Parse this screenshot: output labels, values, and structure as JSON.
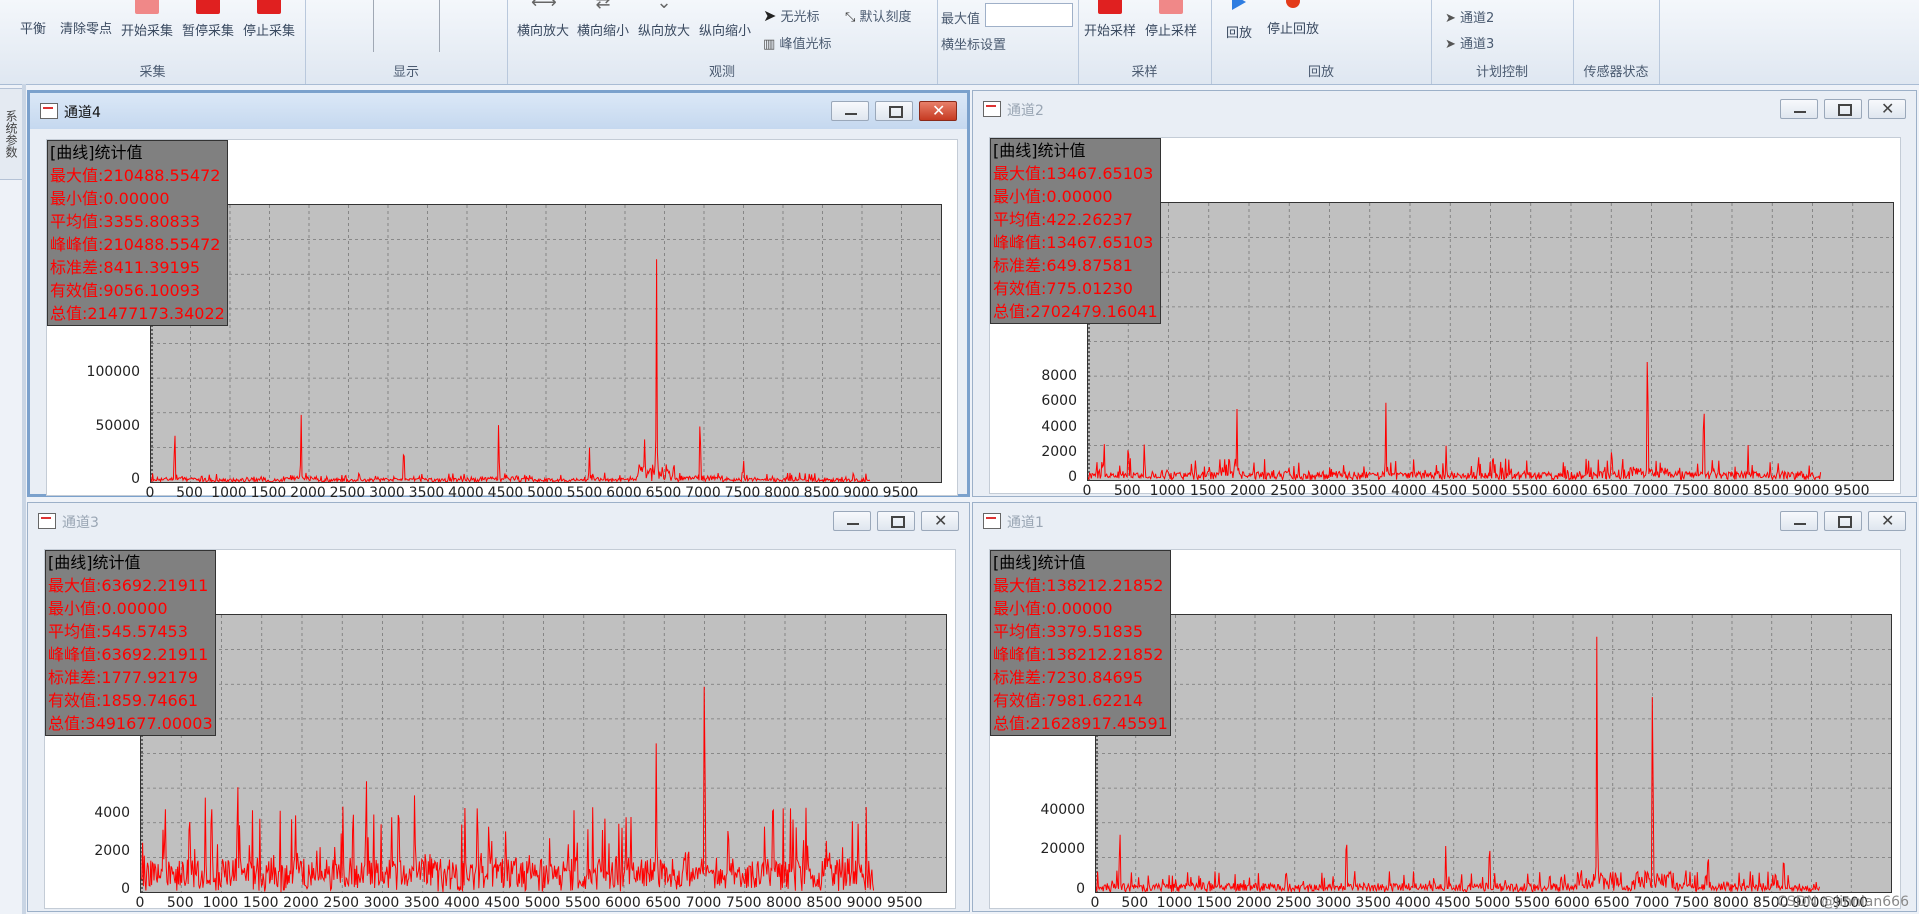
{
  "ribbon": {
    "groups": [
      {
        "label": "采集",
        "buttons": [
          "平衡",
          "清除零点",
          "开始采集",
          "暂停采集",
          "停止采集"
        ]
      },
      {
        "label": "显示"
      },
      {
        "label": "观测",
        "buttons": [
          "横向放大",
          "横向缩小",
          "纵向放大",
          "纵向缩小"
        ],
        "small": [
          "无光标",
          "峰值光标",
          "默认刻度"
        ]
      },
      {
        "label": "",
        "small": [
          "最大值",
          "横坐标设置"
        ]
      },
      {
        "label": "采样",
        "buttons": [
          "开始采样",
          "停止采样"
        ]
      },
      {
        "label": "回放",
        "buttons": [
          "回放",
          "停止回放"
        ]
      },
      {
        "label": "计划控制",
        "small": [
          "通道2",
          "通道3"
        ]
      },
      {
        "label": "传感器状态"
      }
    ],
    "max_input_value": ""
  },
  "side_tab": "系统参数",
  "watermark": "CSDN @jinnian666",
  "windows": [
    {
      "title": "通道4",
      "active": true,
      "stats": {
        "header": "[曲线]统计值",
        "lines": [
          "最大值:210488.55472",
          "最小值:0.00000",
          "平均值:3355.80833",
          "峰峰值:210488.55472",
          "标准差:8411.39195",
          "有效值:9056.10093",
          "总值:21477173.34022"
        ]
      },
      "y_ticks": [
        "100000",
        "50000",
        "0"
      ],
      "x_ticks": [
        "0",
        "500",
        "1000",
        "1500",
        "2000",
        "2500",
        "3000",
        "3500",
        "4000",
        "4500",
        "5000",
        "5500",
        "6000",
        "6500",
        "7000",
        "7500",
        "8000",
        "8500",
        "9000",
        "9500"
      ],
      "chart_data": {
        "type": "line",
        "series": [
          {
            "values": []
          }
        ],
        "x_range": [
          0,
          10000
        ],
        "y_range": [
          0,
          260000
        ],
        "peaks": [
          [
            300,
            60000
          ],
          [
            1900,
            68000
          ],
          [
            3200,
            43000
          ],
          [
            4400,
            62000
          ],
          [
            5550,
            35000
          ],
          [
            6250,
            45000
          ],
          [
            6400,
            215000
          ],
          [
            6950,
            75000
          ],
          [
            7500,
            25000
          ]
        ],
        "noise": 3500
      }
    },
    {
      "title": "通道2",
      "active": false,
      "stats": {
        "header": "[曲线]统计值",
        "lines": [
          "最大值:13467.65103",
          "最小值:0.00000",
          "平均值:422.26237",
          "峰峰值:13467.65103",
          "标准差:649.87581",
          "有效值:775.01230",
          "总值:2702479.16041"
        ]
      },
      "y_ticks": [
        "8000",
        "6000",
        "4000",
        "2000",
        "0"
      ],
      "x_ticks": [
        "0",
        "500",
        "1000",
        "1500",
        "2000",
        "2500",
        "3000",
        "3500",
        "4000",
        "4500",
        "5000",
        "5500",
        "6000",
        "6500",
        "7000",
        "7500",
        "8000",
        "8500",
        "9000",
        "9500"
      ],
      "chart_data": {
        "type": "line",
        "series": [
          {
            "values": []
          }
        ],
        "x_range": [
          0,
          10000
        ],
        "y_range": [
          0,
          22000
        ],
        "peaks": [
          [
            200,
            3500
          ],
          [
            500,
            3800
          ],
          [
            700,
            3500
          ],
          [
            1850,
            5800
          ],
          [
            3700,
            6500
          ],
          [
            4450,
            3000
          ],
          [
            4850,
            2500
          ],
          [
            6950,
            13500
          ],
          [
            7650,
            8000
          ],
          [
            8200,
            2800
          ],
          [
            6500,
            2500
          ]
        ],
        "noise": 700
      }
    },
    {
      "title": "通道3",
      "active": false,
      "stats": {
        "header": "[曲线]统计值",
        "lines": [
          "最大值:63692.21911",
          "最小值:0.00000",
          "平均值:545.57453",
          "峰峰值:63692.21911",
          "标准差:1777.92179",
          "有效值:1859.74661",
          "总值:3491677.00003"
        ]
      },
      "y_ticks": [
        "4000",
        "2000",
        "0"
      ],
      "x_ticks": [
        "0",
        "500",
        "1000",
        "1500",
        "2000",
        "2500",
        "3000",
        "3500",
        "4000",
        "4500",
        "5000",
        "5500",
        "6000",
        "6500",
        "7000",
        "7500",
        "8000",
        "8500",
        "9000",
        "9500"
      ],
      "chart_data": {
        "type": "line",
        "series": [
          {
            "values": []
          }
        ],
        "x_range": [
          0,
          10000
        ],
        "y_range": [
          0,
          14500
        ],
        "peaks": [
          [
            300,
            6000
          ],
          [
            800,
            5500
          ],
          [
            1200,
            7500
          ],
          [
            2800,
            6200
          ],
          [
            3200,
            6800
          ],
          [
            3400,
            6500
          ],
          [
            6400,
            8000
          ],
          [
            7000,
            14500
          ],
          [
            7300,
            2800
          ],
          [
            6800,
            3500
          ]
        ],
        "noise": 1800
      }
    },
    {
      "title": "通道1",
      "active": false,
      "stats": {
        "header": "[曲线]统计值",
        "lines": [
          "最大值:138212.21852",
          "最小值:0.00000",
          "平均值:3379.51835",
          "峰峰值:138212.21852",
          "标准差:7230.84695",
          "有效值:7981.62214",
          "总值:21628917.45591"
        ]
      },
      "y_ticks": [
        "60000",
        "40000",
        "20000",
        "0"
      ],
      "x_ticks": [
        "0",
        "500",
        "1000",
        "1500",
        "2000",
        "2500",
        "3000",
        "3500",
        "4000",
        "4500",
        "5000",
        "5500",
        "6000",
        "6500",
        "7000",
        "7500",
        "8000",
        "8500",
        "9000",
        "9500"
      ],
      "chart_data": {
        "type": "line",
        "series": [
          {
            "values": []
          }
        ],
        "x_range": [
          0,
          10000
        ],
        "y_range": [
          0,
          140000
        ],
        "peaks": [
          [
            300,
            40000
          ],
          [
            3150,
            39000
          ],
          [
            4400,
            27000
          ],
          [
            4950,
            33000
          ],
          [
            6300,
            138000
          ],
          [
            7000,
            133000
          ],
          [
            7700,
            27000
          ],
          [
            8650,
            25000
          ],
          [
            5850,
            12000
          ]
        ],
        "noise": 4500
      }
    }
  ]
}
